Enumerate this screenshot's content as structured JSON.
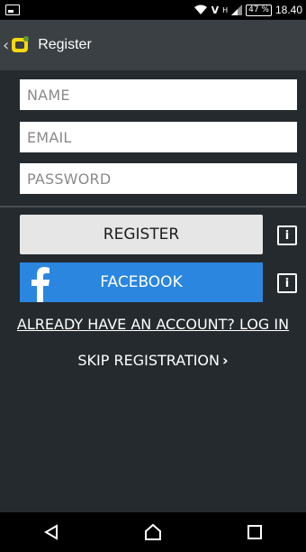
{
  "status_bar": {
    "carrier": "V",
    "network": "H",
    "battery": "47 %",
    "time": "18.40",
    "icons": [
      "notification-icon",
      "wifi-icon",
      "signal-icon",
      "battery-icon"
    ]
  },
  "app_bar": {
    "title": "Register",
    "back_glyph": "‹",
    "logo_colors": {
      "primary": "#f3d80d",
      "accent": "#5a9b2f"
    }
  },
  "form": {
    "name_placeholder": "NAME",
    "email_placeholder": "EMAIL",
    "password_placeholder": "PASSWORD"
  },
  "buttons": {
    "register_label": "REGISTER",
    "facebook_label": "FACEBOOK",
    "info_label": "i",
    "facebook_color": "#2a86df"
  },
  "links": {
    "login": "ALREADY HAVE AN ACCOUNT? LOG IN",
    "skip": "SKIP REGISTRATION",
    "skip_chevron": "›"
  },
  "nav_bar": {
    "icons": [
      "back-icon",
      "home-icon",
      "recents-icon"
    ]
  }
}
